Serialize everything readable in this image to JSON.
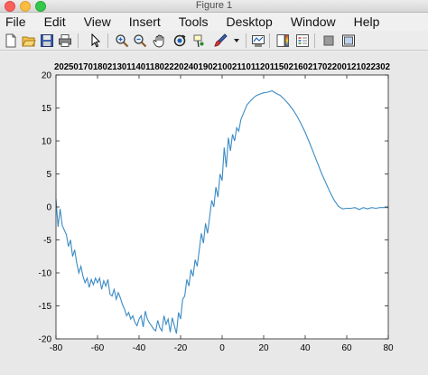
{
  "window": {
    "title": "Figure 1"
  },
  "menu": [
    "File",
    "Edit",
    "View",
    "Insert",
    "Tools",
    "Desktop",
    "Window",
    "Help"
  ],
  "toolbar": {
    "icons": [
      "new-figure-icon",
      "open-file-icon",
      "save-icon",
      "print-icon",
      "edit-plot-arrow-icon",
      "zoom-in-icon",
      "zoom-out-icon",
      "pan-hand-icon",
      "rotate-3d-icon",
      "data-cursor-icon",
      "brush-icon",
      "brush-dropdown-icon",
      "link-plot-icon",
      "colorbar-icon",
      "legend-icon",
      "hide-plot-tools-icon",
      "show-plot-tools-icon"
    ]
  },
  "chart_data": {
    "type": "line",
    "title": "2025017018021301140118022202401902100211011201150216021702200121022302",
    "xlabel": "",
    "ylabel": "",
    "xlim": [
      -80,
      80
    ],
    "ylim": [
      -20,
      20
    ],
    "xticks": [
      -80,
      -60,
      -40,
      -20,
      0,
      20,
      40,
      60,
      80
    ],
    "yticks": [
      -20,
      -15,
      -10,
      -5,
      0,
      5,
      10,
      15,
      20
    ],
    "grid": false,
    "series": [
      {
        "color": "#3b8bc5",
        "x": [
          -80,
          -79,
          -78,
          -77,
          -76,
          -75,
          -74,
          -73,
          -72,
          -71,
          -70,
          -69,
          -68,
          -67,
          -66,
          -65,
          -64,
          -63,
          -62,
          -61,
          -60,
          -59,
          -58,
          -57,
          -56,
          -55,
          -54,
          -53,
          -52,
          -51,
          -50,
          -49,
          -48,
          -47,
          -46,
          -45,
          -44,
          -43,
          -42,
          -41,
          -40,
          -39,
          -38,
          -37,
          -36,
          -35,
          -34,
          -33,
          -32,
          -31,
          -30,
          -29,
          -28,
          -27,
          -26,
          -25,
          -24,
          -23,
          -22,
          -21,
          -20,
          -19,
          -18,
          -17,
          -16,
          -15,
          -14,
          -13,
          -12,
          -11,
          -10,
          -9,
          -8,
          -7,
          -6,
          -5,
          -4,
          -3,
          -2,
          -1,
          0,
          1,
          2,
          3,
          4,
          5,
          6,
          7,
          8,
          9,
          10,
          12,
          14,
          16,
          18,
          20,
          22,
          24,
          26,
          28,
          30,
          32,
          34,
          36,
          38,
          40,
          42,
          44,
          46,
          48,
          50,
          52,
          54,
          56,
          58,
          60,
          62,
          64,
          66,
          68,
          70,
          72,
          74,
          76,
          78,
          80
        ],
        "y": [
          1.2,
          -3.0,
          -0.3,
          -2.8,
          -3.5,
          -4.2,
          -6.0,
          -5.0,
          -7.5,
          -6.5,
          -8.5,
          -10.0,
          -9.0,
          -10.5,
          -11.5,
          -10.8,
          -12.2,
          -11.0,
          -11.8,
          -10.8,
          -11.5,
          -10.8,
          -12.5,
          -11.2,
          -12.0,
          -11.0,
          -13.2,
          -13.5,
          -12.5,
          -14.0,
          -13.0,
          -13.8,
          -14.8,
          -15.5,
          -16.5,
          -16.0,
          -17.0,
          -16.5,
          -17.5,
          -18.0,
          -17.0,
          -16.5,
          -18.2,
          -15.8,
          -17.0,
          -17.6,
          -18.0,
          -18.5,
          -18.8,
          -17.2,
          -18.3,
          -18.8,
          -16.5,
          -17.8,
          -17.0,
          -19.0,
          -16.8,
          -18.0,
          -19.2,
          -16.0,
          -17.0,
          -14.0,
          -13.5,
          -11.0,
          -12.0,
          -9.5,
          -10.5,
          -8.0,
          -9.0,
          -6.5,
          -4.0,
          -5.5,
          -2.5,
          -4.0,
          -1.5,
          1.0,
          0.0,
          3.0,
          1.5,
          5.0,
          4.0,
          9.0,
          6.0,
          10.5,
          8.5,
          11.0,
          10.0,
          12.0,
          11.5,
          13.2,
          14.0,
          15.5,
          16.2,
          16.8,
          17.1,
          17.3,
          17.4,
          17.6,
          17.2,
          16.9,
          16.3,
          15.6,
          14.8,
          13.8,
          12.6,
          11.3,
          9.8,
          8.2,
          6.6,
          5.0,
          3.6,
          2.2,
          1.0,
          0.1,
          -0.3,
          -0.2,
          -0.2,
          -0.1,
          -0.4,
          -0.1,
          -0.3,
          -0.1,
          -0.2,
          -0.1,
          -0.1,
          -0.1
        ]
      }
    ]
  }
}
